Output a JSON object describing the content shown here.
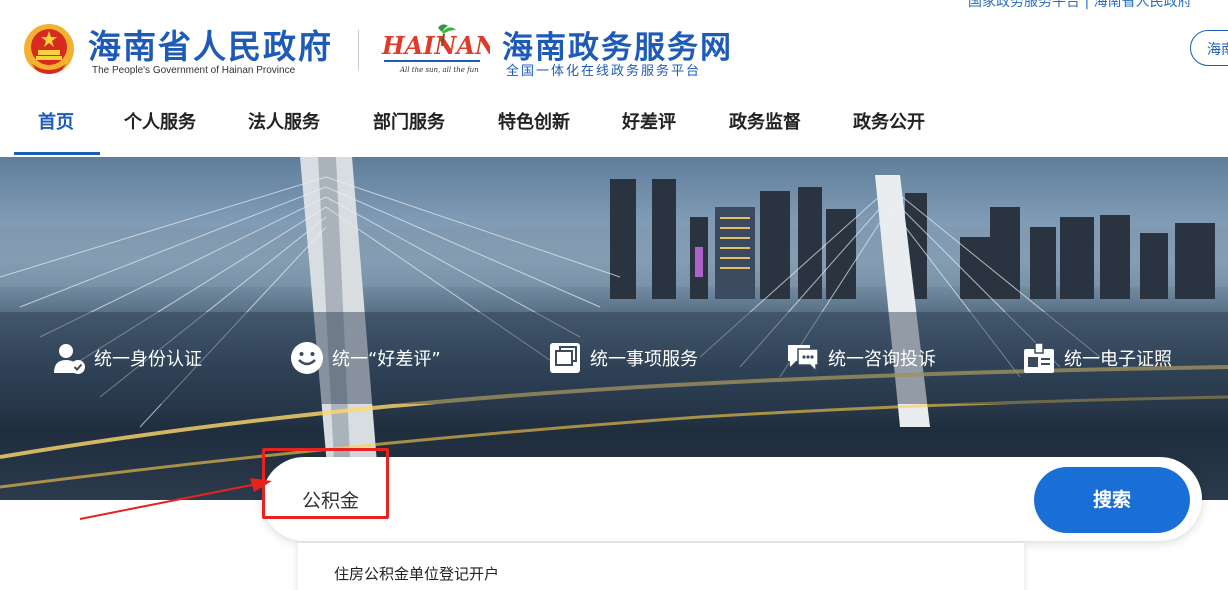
{
  "header": {
    "gov_title": "海南省人民政府",
    "gov_subtitle": "The People's Government of Hainan Province",
    "hainan_logo_text": "HAINAN",
    "hainan_logo_slogan": "All the sun, all the fun",
    "service_title": "海南政务服务网",
    "service_subtitle": "全国一体化在线政务服务平台",
    "region_button": "海南",
    "top_strip": "国家政务服务平台  |  海南省人民政府"
  },
  "nav": {
    "items": [
      {
        "label": "首页"
      },
      {
        "label": "个人服务"
      },
      {
        "label": "法人服务"
      },
      {
        "label": "部门服务"
      },
      {
        "label": "特色创新"
      },
      {
        "label": "好差评"
      },
      {
        "label": "政务监督"
      },
      {
        "label": "政务公开"
      }
    ],
    "active_index": 0
  },
  "features": [
    {
      "label": "统一身份认证",
      "icon": "user-verified-icon"
    },
    {
      "label": "统一“好差评”",
      "icon": "smiley-icon"
    },
    {
      "label": "统一事项服务",
      "icon": "stacked-windows-icon"
    },
    {
      "label": "统一咨询投诉",
      "icon": "chat-bubble-icon"
    },
    {
      "label": "统一电子证照",
      "icon": "id-card-icon"
    }
  ],
  "search": {
    "value": "公积金",
    "button_label": "搜索",
    "suggestions": [
      "住房公积金单位登记开户"
    ]
  },
  "colors": {
    "brand_blue": "#1e5bb8",
    "search_button": "#1a6fd6",
    "annotation_red": "#e6231f"
  }
}
